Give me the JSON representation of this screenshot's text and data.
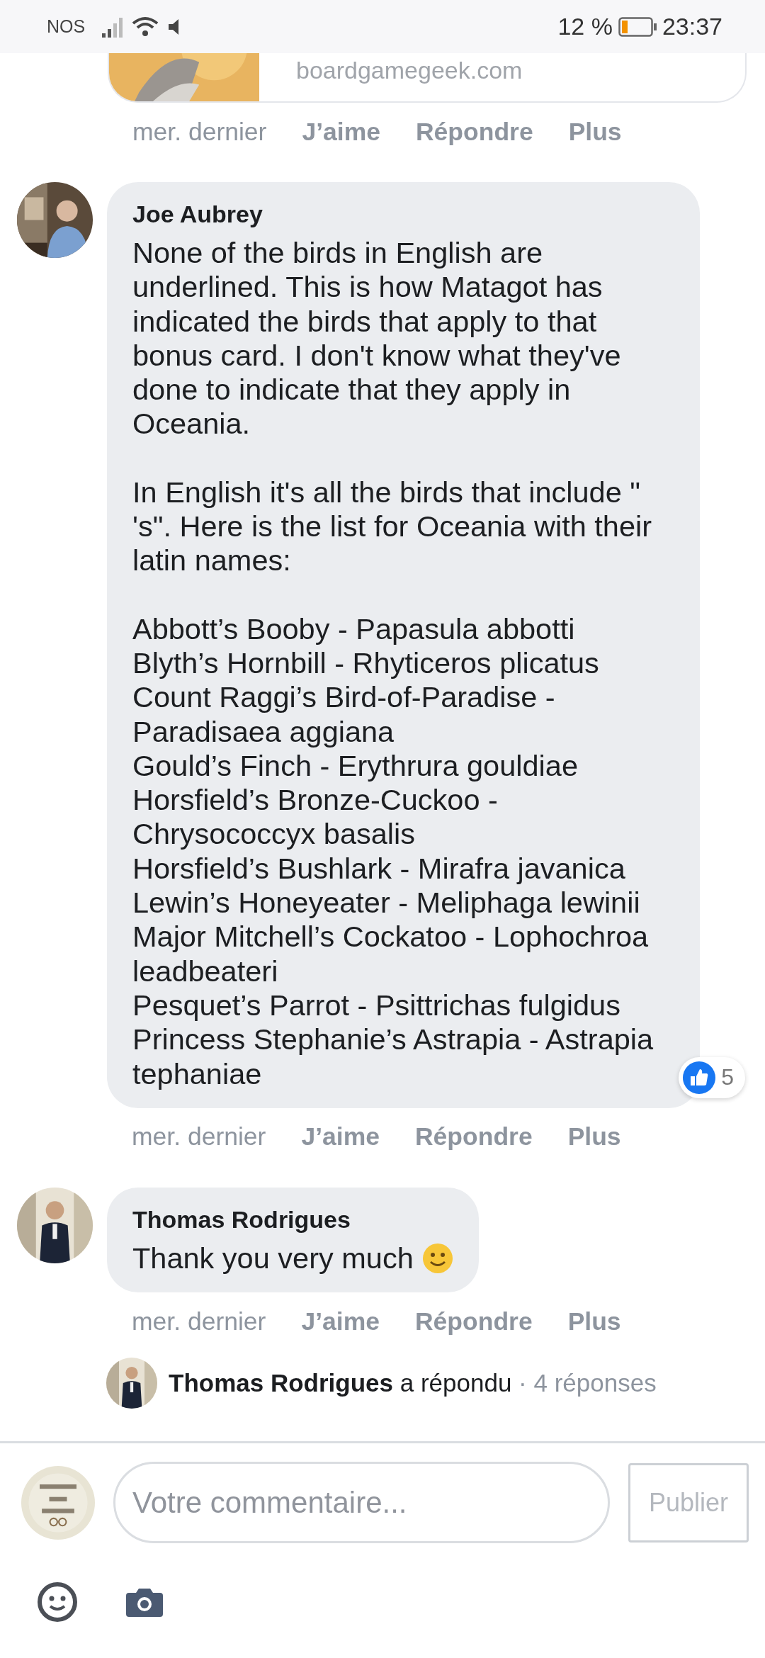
{
  "status_bar": {
    "carrier": "NOS",
    "battery_text": "12 %",
    "time": "23:37"
  },
  "comments": [
    {
      "kind": "link",
      "link_preview": {
        "domain": "boardgamegeek.com"
      },
      "time": "mer. dernier",
      "actions": [
        "J’aime",
        "Répondre",
        "Plus"
      ]
    },
    {
      "kind": "text",
      "author": "Joe Aubrey",
      "paragraphs": [
        "None of the birds in English are underlined. This is how Matagot has indicated the birds that apply to that bonus card. I don't know what they've done to indicate that they apply in Oceania.",
        "In English it's all the birds that include \" 's\". Here is the list for Oceania with their latin names:"
      ],
      "list": [
        "Abbott’s Booby - Papasula abbotti",
        "Blyth’s Hornbill - Rhyticeros plicatus",
        "Count Raggi’s Bird-of-Paradise - Paradisaea aggiana",
        "Gould’s Finch - Erythrura gouldiae",
        "Horsfield’s Bronze-Cuckoo - Chrysococcyx basalis",
        "Horsfield’s Bushlark - Mirafra javanica",
        "Lewin’s Honeyeater - Meliphaga lewinii",
        "Major Mitchell’s Cockatoo - Lophochroa leadbeateri",
        "Pesquet’s Parrot - Psittrichas fulgidus",
        "Princess Stephanie’s Astrapia - Astrapia tephaniae"
      ],
      "reactions": "5",
      "time": "mer. dernier",
      "actions": [
        "J’aime",
        "Répondre",
        "Plus"
      ]
    },
    {
      "kind": "text",
      "author": "Thomas Rodrigues",
      "paragraphs": [
        "Thank you very much"
      ],
      "emoji": true,
      "time": "mer. dernier",
      "actions": [
        "J’aime",
        "Répondre",
        "Plus"
      ]
    }
  ],
  "reply_summary": {
    "author": "Thomas Rodrigues",
    "verb": "a répondu",
    "count": "· 4 réponses"
  },
  "composer": {
    "placeholder": "Votre commentaire...",
    "publish": {
      "label": "Publier",
      "disabled": true
    }
  }
}
